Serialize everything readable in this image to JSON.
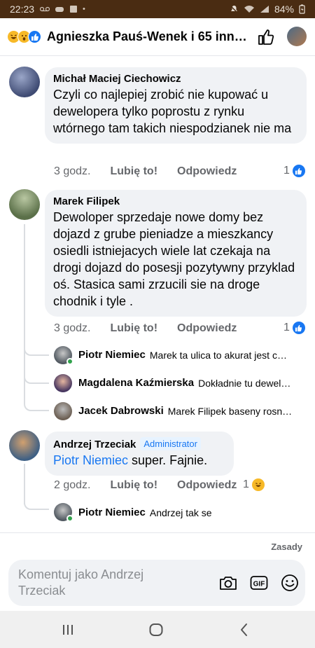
{
  "status_bar": {
    "time": "22:23",
    "battery": "84%"
  },
  "header": {
    "title": "Agnieszka Pauś-Wenek i 65 inn…"
  },
  "comments": [
    {
      "author": "Michał Maciej Ciechowicz",
      "text": "Czyli co najlepiej zrobić nie kupować u dewelopera tylko poprostu z rynku wtórnego tam takich niespodzianek nie ma",
      "time": "3 godz.",
      "like_label": "Lubię to!",
      "reply_label": "Odpowiedz",
      "reaction_count": "1"
    },
    {
      "author": "Marek Filipek",
      "text": "Dewoloper sprzedaje  nowe domy  bez dojazd z grube pieniadze a mieszkancy osiedli istniejacych wiele lat czekaja na drogi dojazd do posesji pozytywny przyklad oś. Stasica sami zrzucili sie na droge chodnik i tyle .",
      "time": "3 godz.",
      "like_label": "Lubię to!",
      "reply_label": "Odpowiedz",
      "reaction_count": "1",
      "replies": [
        {
          "author": "Piotr Niemiec",
          "text": "Marek ta ulica to akurat jest c…"
        },
        {
          "author": "Magdalena Kaźmierska",
          "text": "Dokładnie tu dewel…"
        },
        {
          "author": "Jacek Dabrowski",
          "text": "Marek Filipek baseny rosn…"
        }
      ]
    },
    {
      "author": "Andrzej Trzeciak",
      "badge": "Administrator",
      "mention": "Piotr Niemiec",
      "text": " super. Fajnie.",
      "time": "2 godz.",
      "like_label": "Lubię to!",
      "reply_label": "Odpowiedz",
      "reaction_count": "1",
      "replies": [
        {
          "author": "Piotr Niemiec",
          "text": "Andrzej tak se"
        }
      ]
    }
  ],
  "footer": {
    "rules_label": "Zasady",
    "composer_placeholder": "Komentuj jako Andrzej Trzeciak"
  },
  "colors": {
    "accent": "#1877f2",
    "bubble": "#f0f2f5",
    "status_bar": "#4a2c12"
  }
}
